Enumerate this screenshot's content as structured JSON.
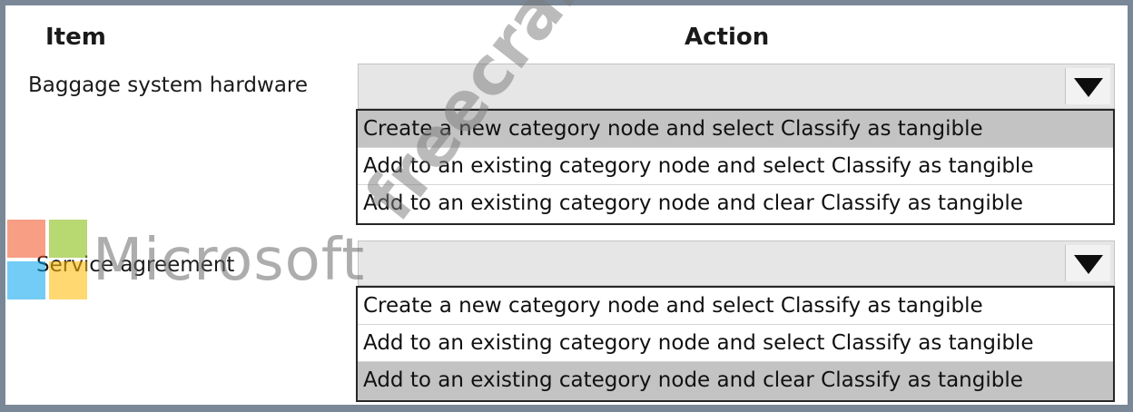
{
  "headers": {
    "item": "Item",
    "action": "Action"
  },
  "rows": [
    {
      "label": "Baggage system hardware",
      "options": [
        "Create a new category node and select Classify as tangible",
        "Add to an existing category node and select Classify as tangible",
        "Add to an existing category node and clear Classify as tangible"
      ],
      "selected_index": 0
    },
    {
      "label": "Service agreement",
      "options": [
        "Create a new category node and select Classify as tangible",
        "Add to an existing category node and select Classify as tangible",
        "Add to an existing category node and clear Classify as tangible"
      ],
      "selected_index": 2
    }
  ],
  "icons": {
    "dropdown_arrow": "triangle-down-icon",
    "brand_logo": "microsoft-logo-icon"
  },
  "watermarks": {
    "brand_text": "Microsoft",
    "site_text": "freecram.net"
  },
  "colors": {
    "frame": "#7a8797",
    "selected_option_bg": "#c3c3c3",
    "dropdown_bg": "#e6e6e6"
  }
}
